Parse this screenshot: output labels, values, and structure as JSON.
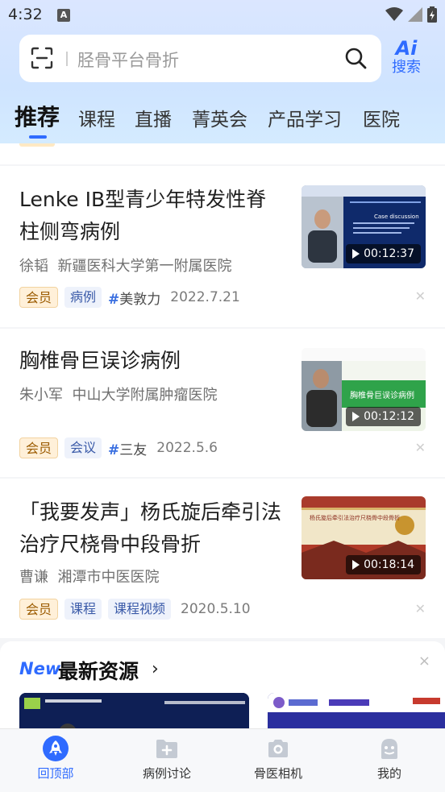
{
  "status_bar": {
    "time": "4:32",
    "notification_glyph": "A"
  },
  "search": {
    "placeholder": "胫骨平台骨折",
    "ai_logo": "Ai",
    "ai_label": "搜索"
  },
  "tabs": [
    {
      "label": "推荐",
      "active": true
    },
    {
      "label": "课程"
    },
    {
      "label": "直播"
    },
    {
      "label": "菁英会"
    },
    {
      "label": "产品学习"
    },
    {
      "label": "医院"
    }
  ],
  "feed": [
    {
      "title": "Lenke IB型青少年特发性脊柱侧弯病例",
      "author": "徐韬",
      "hospital": "新疆医科大学第一附属医院",
      "tags": [
        "会员",
        "病例"
      ],
      "hashtag": "美敦力",
      "date": "2022.7.21",
      "duration": "00:12:37",
      "thumb_text": "Case discussion"
    },
    {
      "title": "胸椎骨巨误诊病例",
      "author": "朱小军",
      "hospital": "中山大学附属肿瘤医院",
      "tags": [
        "会员",
        "会议"
      ],
      "hashtag": "三友",
      "date": "2022.5.6",
      "duration": "00:12:12",
      "thumb_text": "胸椎骨巨误诊病例"
    },
    {
      "title": "「我要发声」杨氏旋后牵引法治疗尺桡骨中段骨折",
      "author": "曹谦",
      "hospital": "湘潭市中医医院",
      "tags": [
        "会员",
        "课程",
        "课程视频"
      ],
      "hashtag": "",
      "date": "2020.5.10",
      "duration": "00:18:14",
      "thumb_text": "杨氏旋后牵引法治疗尺桡骨中段骨折"
    }
  ],
  "new_resources": {
    "logo": "New",
    "title": "最新资源",
    "chevron": "›",
    "close": "×"
  },
  "bottom_nav": [
    {
      "label": "回顶部",
      "icon": "rocket-icon",
      "active": true
    },
    {
      "label": "病例讨论",
      "icon": "folder-plus-icon"
    },
    {
      "label": "骨医相机",
      "icon": "camera-icon"
    },
    {
      "label": "我的",
      "icon": "profile-icon"
    }
  ],
  "colors": {
    "accent": "#2f6bff",
    "member_tag": "#fff0d9",
    "type_tag": "#eef2fb"
  }
}
